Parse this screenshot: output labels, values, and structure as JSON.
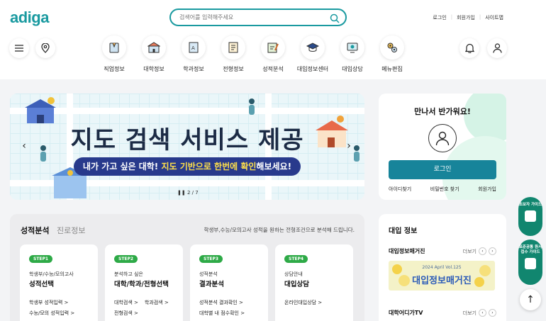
{
  "header": {
    "logo": "adiga",
    "search_placeholder": "검색어를 입력해주세요",
    "links": [
      "로그인",
      "회원가입",
      "사이트맵"
    ]
  },
  "nav": [
    {
      "label": "직업정보",
      "icon": "job-icon"
    },
    {
      "label": "대학정보",
      "icon": "university-icon"
    },
    {
      "label": "학과정보",
      "icon": "book-icon"
    },
    {
      "label": "전형정보",
      "icon": "document-icon"
    },
    {
      "label": "성적분석",
      "icon": "analysis-icon"
    },
    {
      "label": "대입정보센터",
      "icon": "graduation-cap-icon"
    },
    {
      "label": "대입상담",
      "icon": "counsel-icon"
    },
    {
      "label": "메뉴편집",
      "icon": "gear-icon"
    }
  ],
  "banner": {
    "headline": "지도 검색 서비스 제공",
    "pill_pre": "내가 가고 싶은 대학! ",
    "pill_hl": "지도 기반으로 한번에 확인",
    "pill_post": "해보세요!",
    "pager": "2 / 7"
  },
  "login": {
    "greeting": "만나서 반가워요!",
    "button": "로그인",
    "links": [
      "아이디찾기",
      "비밀번호 찾기",
      "회원가입"
    ]
  },
  "grades": {
    "title": "성적분석",
    "title2": "진로정보",
    "desc": "학생부,수능/모의고사 성적을 원하는 전형조건으로 분석해 드립니다.",
    "steps": [
      {
        "badge": "STEP1",
        "sub": "학생부/수능/모의고사",
        "head": "성적선택",
        "links": [
          "학생부 성적입력 >",
          "수능/모의 성적입력 >"
        ]
      },
      {
        "badge": "STEP2",
        "sub": "분석하고 싶은",
        "head": "대학/학과/전형선택",
        "links": [
          "대학검색 >",
          "학과검색 >",
          "전형검색 >"
        ]
      },
      {
        "badge": "STEP3",
        "sub": "성적분석",
        "head": "결과분석",
        "links": [
          "성적분석 결과확인 >",
          "대학별 내 점수확인 >"
        ]
      },
      {
        "badge": "STEP4",
        "sub": "상담안내",
        "head": "대입상담",
        "links": [
          "온라인대입상담 >"
        ]
      }
    ]
  },
  "admission": {
    "title": "대입 정보",
    "magazine_row": "대입정보매거진",
    "tv_row": "대학어디가TV",
    "more": "더보기",
    "magazine_vol": "2024 April Vol.125",
    "magazine_title": "대입정보매거진"
  },
  "floats": [
    {
      "label": "초보자 가이드"
    },
    {
      "label": "표준공통 원서접수 가이드"
    }
  ],
  "colors": {
    "brand": "#1a9aa0",
    "login_button": "#17849a",
    "step_badge": "#2eaa47",
    "float": "#11866f"
  }
}
